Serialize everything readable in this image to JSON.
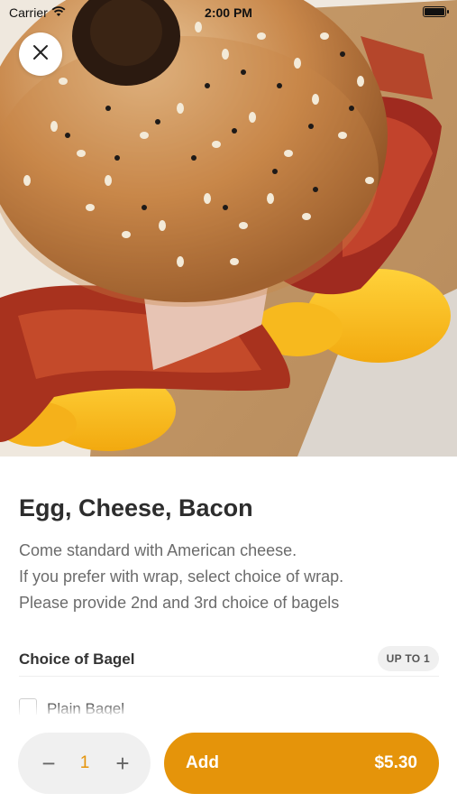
{
  "status_bar": {
    "carrier": "Carrier",
    "time": "2:00 PM"
  },
  "hero": {
    "image_subject": "bagel sandwich with egg, cheese and bacon",
    "close_icon": "close-icon"
  },
  "item": {
    "title": "Egg, Cheese, Bacon",
    "description_lines": [
      "Come standard with American cheese.",
      "If you prefer with wrap, select choice of wrap.",
      "Please provide 2nd and 3rd choice of bagels"
    ]
  },
  "options_section": {
    "title": "Choice of Bagel",
    "badge": "UP TO 1",
    "options": [
      {
        "label": "Plain Bagel",
        "checked": false
      }
    ]
  },
  "cart": {
    "quantity": "1",
    "minus_label": "−",
    "plus_label": "+",
    "add_label": "Add",
    "price": "$5.30"
  },
  "colors": {
    "accent": "#e5940a",
    "stepper_bg": "#f0f0f0",
    "text_primary": "#2d2d2d",
    "text_secondary": "#6b6b6b"
  }
}
